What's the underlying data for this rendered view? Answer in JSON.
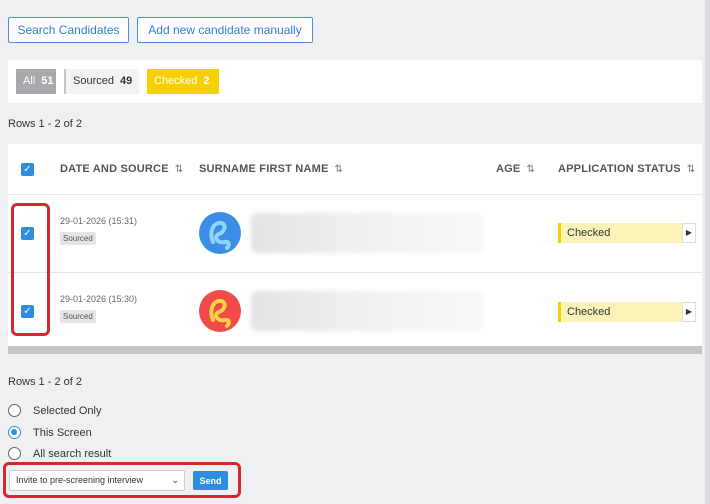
{
  "toolbar": {
    "search_candidates": "Search Candidates",
    "add_candidate": "Add new candidate manually"
  },
  "filters": [
    {
      "label": "All",
      "count": "51"
    },
    {
      "label": "Sourced",
      "count": "49"
    },
    {
      "label": "Checked",
      "count": "2"
    }
  ],
  "rows_info": "Rows 1 - 2 of 2",
  "table": {
    "columns": [
      "DATE AND SOURCE",
      "SURNAME FIRST NAME",
      "AGE",
      "APPLICATION STATUS"
    ],
    "rows": [
      {
        "date": "29-01-2026 (15:31)",
        "source": "Sourced",
        "status": "Checked",
        "avatar_color": "#3a8ee6",
        "avatar_stroke": "#8ed6ff"
      },
      {
        "date": "29-01-2026 (15:30)",
        "source": "Sourced",
        "status": "Checked",
        "avatar_color": "#f04a4a",
        "avatar_stroke": "#ffd24a"
      }
    ]
  },
  "scope_options": [
    "Selected Only",
    "This Screen",
    "All search result"
  ],
  "scope_selected": "This Screen",
  "action_select": "Invite to pre-screening interview",
  "send_label": "Send",
  "colors": {
    "accent": "#2d8ee0",
    "checked": "#f7d000",
    "highlight": "#d7262e"
  }
}
